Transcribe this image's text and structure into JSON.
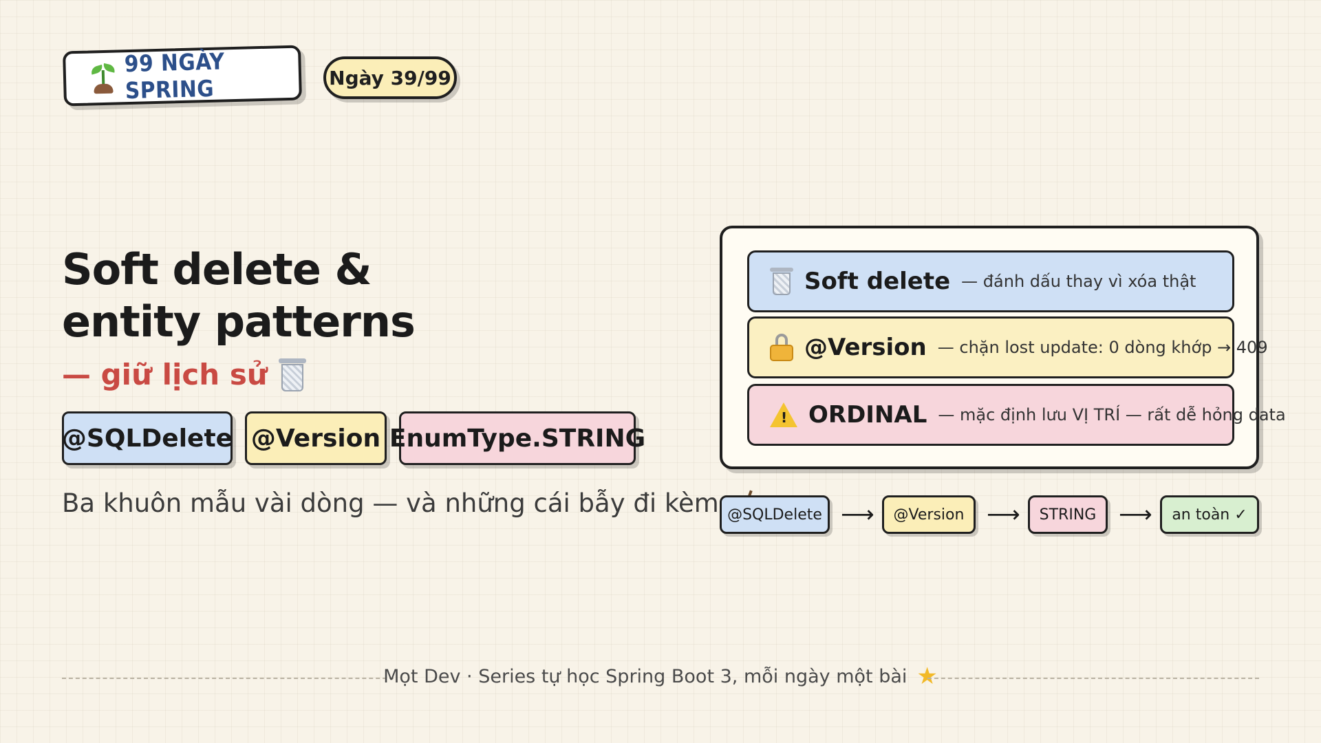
{
  "header": {
    "series_label": "99 NGÀY SPRING",
    "day_label": "Ngày 39/99"
  },
  "hero": {
    "title_line1": "Soft delete &",
    "title_line2": "entity patterns",
    "subtitle": "— giữ lịch sử",
    "chips": [
      "@SQLDelete",
      "@Version",
      "EnumType.STRING"
    ],
    "tagline": "Ba khuôn mẫu vài dòng — và những cái bẫy đi kèm"
  },
  "panel": {
    "rows": [
      {
        "icon": "trash-icon",
        "title": "Soft delete",
        "desc": "— đánh dấu thay vì xóa thật"
      },
      {
        "icon": "lock-icon",
        "title": "@Version",
        "desc": "— chặn lost update: 0 dòng khớp → 409"
      },
      {
        "icon": "warning-icon",
        "title": "ORDINAL",
        "desc": "— mặc định lưu VỊ TRÍ — rất dễ hỏng data"
      }
    ]
  },
  "flow": {
    "steps": [
      "@SQLDelete",
      "@Version",
      "STRING",
      "an toàn ✓"
    ],
    "arrow": "⟶"
  },
  "footer": {
    "text": "Mọt Dev · Series tự học Spring Boot 3, mỗi ngày một bài",
    "icon": "star-icon"
  },
  "colors": {
    "background": "#f8f3e8",
    "blue": "#cfe0f5",
    "yellow": "#fbeeb8",
    "pink": "#f7d6dc",
    "green": "#d8efd0",
    "accent_red": "#c94a43",
    "series_blue": "#2c4f8a"
  }
}
